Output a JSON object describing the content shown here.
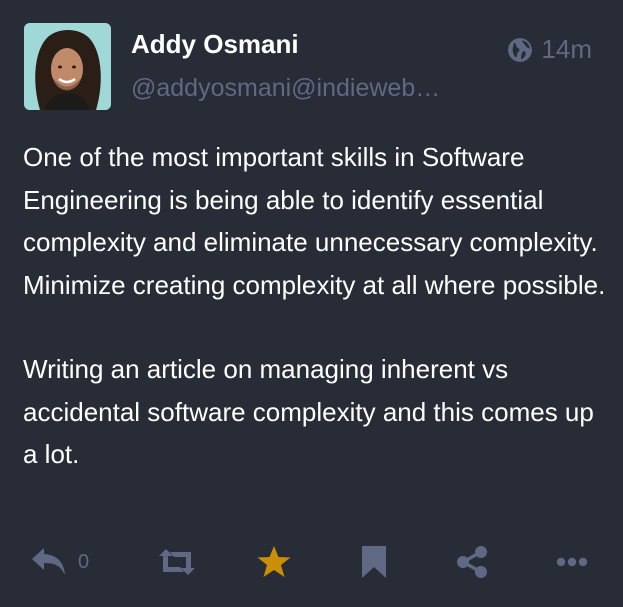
{
  "author": {
    "display_name": "Addy Osmani",
    "handle": "@addyosmani@indieweb…"
  },
  "meta": {
    "visibility_icon": "globe-icon",
    "time": "14m"
  },
  "content": {
    "paragraphs": [
      "One of the most important skills in Software Engineering is being able to identify essential complexity and eliminate unnecessary complexity. Minimize creating complexity at all where possible.",
      "Writing an article on managing inherent vs accidental software complexity and this comes up a lot."
    ]
  },
  "actions": {
    "reply_count": "0",
    "icons": [
      "reply-icon",
      "boost-icon",
      "favourite-icon",
      "bookmark-icon",
      "share-icon",
      "more-icon"
    ],
    "favourited": true
  },
  "colors": {
    "background": "#282c37",
    "text": "#ffffff",
    "muted": "#606984",
    "favourite": "#ca8f04"
  }
}
